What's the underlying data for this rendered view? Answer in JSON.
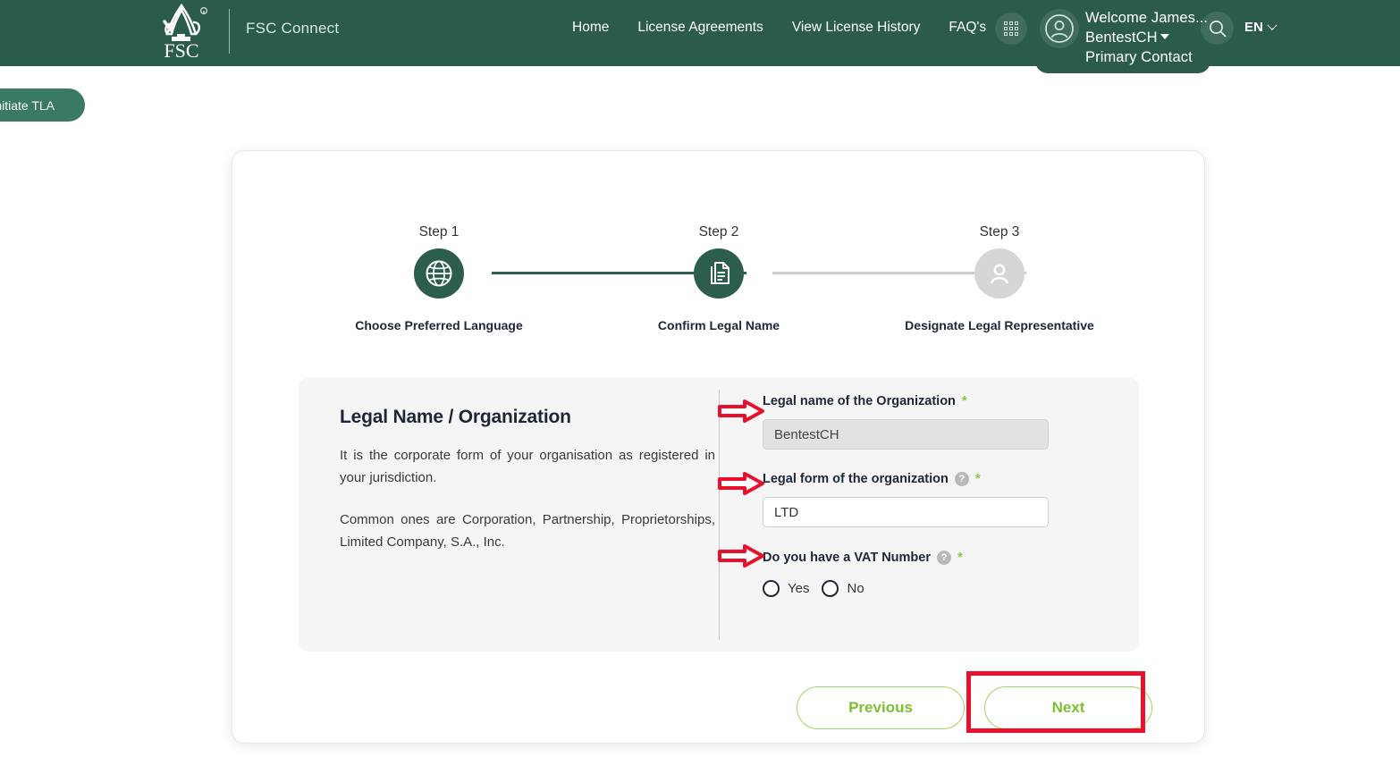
{
  "header": {
    "brand": "FSC Connect",
    "logo_icon": "fsc-tree-logo",
    "nav": [
      {
        "label": "Home"
      },
      {
        "label": "License Agreements"
      },
      {
        "label": "View License History"
      },
      {
        "label": "FAQ's"
      }
    ],
    "apps_icon": "grid-apps-icon",
    "avatar_icon": "user-avatar-icon",
    "user": {
      "welcome": "Welcome James...",
      "organization": "BentestCH",
      "role": "Primary Contact"
    },
    "search_icon": "search-icon",
    "language": {
      "value": "EN",
      "caret_icon": "chevron-down-icon"
    }
  },
  "side_tag": {
    "label": "Initiate TLA"
  },
  "stepper": {
    "steps": [
      {
        "title": "Step 1",
        "label": "Choose Preferred Language",
        "icon": "globe-icon",
        "state": "active"
      },
      {
        "title": "Step 2",
        "label": "Confirm Legal Name",
        "icon": "documents-icon",
        "state": "active"
      },
      {
        "title": "Step 3",
        "label": "Designate Legal Representative",
        "icon": "person-icon",
        "state": "inactive"
      }
    ]
  },
  "panel": {
    "title": "Legal Name / Organization",
    "paragraph_1": "It is the corporate form of your organisation as registered in your jurisdiction.",
    "paragraph_2": "Common ones are Corporation, Partnership,  Proprietorships, Limited Company, S.A., Inc.",
    "fields": {
      "legal_name": {
        "label": "Legal name of the Organization",
        "required_marker": "*",
        "value": "BentestCH",
        "placeholder": ""
      },
      "legal_form": {
        "label": "Legal form of the organization",
        "help_icon": "help-question-icon",
        "help_glyph": "?",
        "required_marker": "*",
        "value": "LTD",
        "placeholder": ""
      },
      "vat": {
        "label": "Do you have a VAT Number",
        "help_icon": "help-question-icon",
        "help_glyph": "?",
        "required_marker": "*",
        "options": [
          {
            "label": "Yes",
            "selected": false
          },
          {
            "label": "No",
            "selected": false
          }
        ]
      }
    }
  },
  "actions": {
    "previous": "Previous",
    "next": "Next"
  },
  "annotations": {
    "arrow_icon": "red-arrow-right-icon",
    "highlight_icon": "red-highlight-box",
    "accent_color": "#e8112d"
  },
  "colors": {
    "header_green": "#2b5b4b",
    "step_active": "#2d5d4c",
    "step_inactive": "#d6d6d6",
    "button_green": "#7cc030",
    "button_border": "#a3d35f",
    "required_green": "#8dc63f",
    "panel_bg": "#f5f5f5"
  }
}
